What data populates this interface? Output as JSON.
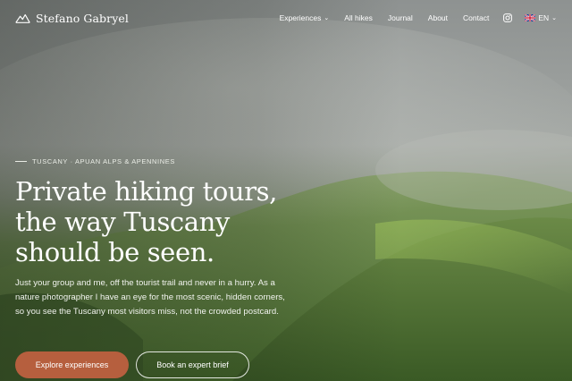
{
  "brand": {
    "name": "Stefano Gabryel",
    "logo_icon": "mountain-icon"
  },
  "nav": {
    "items": [
      {
        "label": "Experiences",
        "has_dropdown": true
      },
      {
        "label": "All hikes"
      },
      {
        "label": "Journal"
      },
      {
        "label": "About"
      },
      {
        "label": "Contact"
      }
    ],
    "instagram_icon": "instagram-icon",
    "language": {
      "flag_icon": "uk-flag-icon",
      "code": "EN"
    }
  },
  "hero": {
    "eyebrow": "TUSCANY · APUAN ALPS & APENNINES",
    "title_lines": [
      "Private hiking tours,",
      "the way Tuscany",
      "should be seen."
    ],
    "description": "Just your group and me, off the tourist trail and never in a hurry. As a nature photographer I have an eye for the most scenic, hidden corners, so you see the Tuscany most visitors miss, not the crowded postcard.",
    "primary_cta": "Explore experiences",
    "secondary_cta": "Book an expert brief"
  },
  "colors": {
    "accent": "#b65f3e",
    "text": "#ffffff"
  }
}
